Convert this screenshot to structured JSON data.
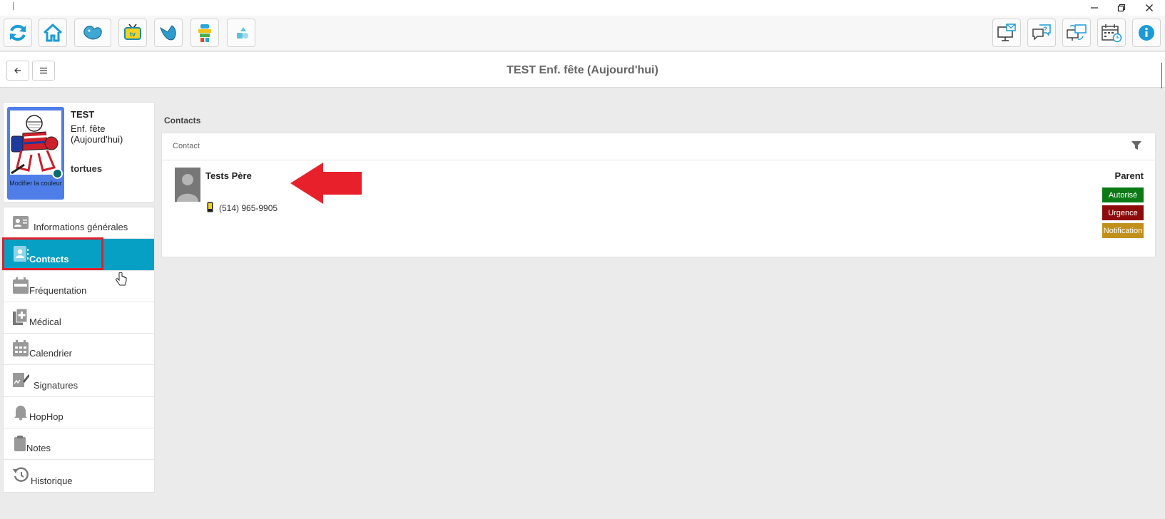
{
  "window": {
    "minimize_icon": "minimize-icon",
    "restore_icon": "restore-icon",
    "close_icon": "close-icon"
  },
  "toolbar": {
    "left_buttons": [
      "refresh-icon",
      "home-icon",
      "bird-app-icon",
      "tv-icon",
      "paper-bird-icon",
      "character-icon",
      "shapes-icon"
    ],
    "right_buttons": [
      "monitor-message-icon",
      "help-chat-icon",
      "remote-screen-icon",
      "calendar-clock-icon",
      "info-icon"
    ]
  },
  "header": {
    "title": "TEST Enf. fête (Aujourd'hui)"
  },
  "profile": {
    "name": "TEST",
    "subtitle": "Enf. fête (Aujourd'hui)",
    "group": "tortues",
    "avatar_caption": "Modifier la couleur"
  },
  "menu": {
    "items": [
      {
        "label": "Informations générales",
        "icon": "id-card-icon"
      },
      {
        "label": "Contacts",
        "icon": "contact-book-icon",
        "active": true
      },
      {
        "label": "Fréquentation",
        "icon": "calendar-bar-icon"
      },
      {
        "label": "Médical",
        "icon": "medical-file-icon"
      },
      {
        "label": "Calendrier",
        "icon": "calendar-grid-icon"
      },
      {
        "label": "Signatures",
        "icon": "signature-icon"
      },
      {
        "label": "HopHop",
        "icon": "bell-icon"
      },
      {
        "label": "Notes",
        "icon": "clipboard-icon"
      },
      {
        "label": "Historique",
        "icon": "history-icon"
      }
    ]
  },
  "contacts": {
    "section_title": "Contacts",
    "column_header": "Contact",
    "entries": [
      {
        "name": "Tests Père",
        "phone": "(514) 965-9905",
        "relation": "Parent",
        "badges": [
          {
            "label": "Autorisé",
            "color": "#0b7a16"
          },
          {
            "label": "Urgence",
            "color": "#8e0b0b"
          },
          {
            "label": "Notification",
            "color": "#c1901a"
          }
        ]
      }
    ]
  },
  "colors": {
    "accent": "#07a0c5",
    "highlight": "#e0202a"
  }
}
